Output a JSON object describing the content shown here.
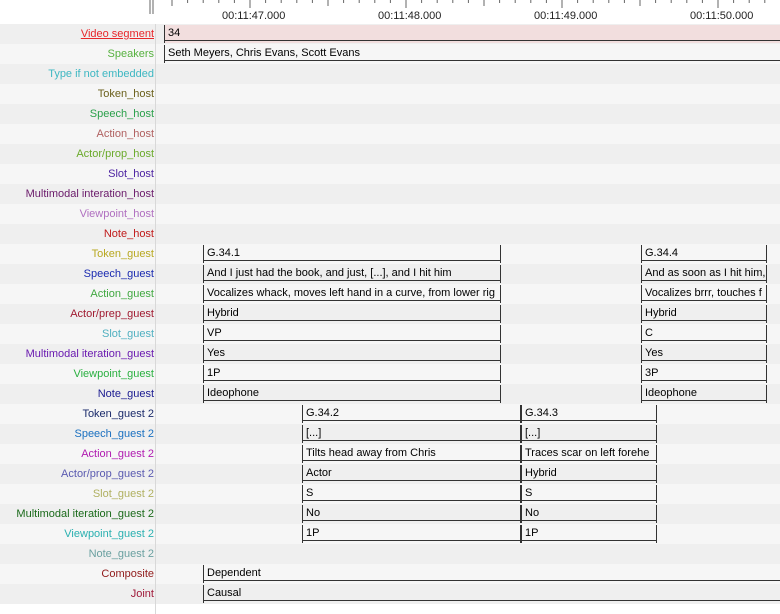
{
  "ruler": {
    "time_labels": [
      "00:11:47.000",
      "00:11:48.000",
      "00:11:49.000",
      "00:11:50.000"
    ]
  },
  "tiers": [
    {
      "label": "Video segment",
      "color": "#e8262a",
      "selected": true
    },
    {
      "label": "Speakers",
      "color": "#56b13f"
    },
    {
      "label": "Type if not embedded",
      "color": "#3db7c2"
    },
    {
      "label": "Token_host",
      "color": "#6a5f1a"
    },
    {
      "label": "Speech_host",
      "color": "#2aa04a"
    },
    {
      "label": "Action_host",
      "color": "#b06060"
    },
    {
      "label": "Actor/prop_host",
      "color": "#6aaa2a"
    },
    {
      "label": "Slot_host",
      "color": "#4a1fa0"
    },
    {
      "label": "Multimodal interation_host",
      "color": "#6a1a6a"
    },
    {
      "label": "Viewpoint_host",
      "color": "#b070c0"
    },
    {
      "label": "Note_host",
      "color": "#c01a1a"
    },
    {
      "label": "Token_guest",
      "color": "#b8a820"
    },
    {
      "label": "Speech_guest",
      "color": "#1a2ab0"
    },
    {
      "label": "Action_guest",
      "color": "#40a840"
    },
    {
      "label": "Actor/prep_guest",
      "color": "#a01a30"
    },
    {
      "label": "Slot_guest",
      "color": "#50b0c0"
    },
    {
      "label": "Multimodal iteration_guest",
      "color": "#6a1ab0"
    },
    {
      "label": "Viewpoint_guest",
      "color": "#2ab040"
    },
    {
      "label": "Note_guest",
      "color": "#1a1a90"
    },
    {
      "label": "Token_guest 2",
      "color": "#1a2a6a"
    },
    {
      "label": "Speech_guest 2",
      "color": "#1a70c0"
    },
    {
      "label": "Action_guest 2",
      "color": "#b01ab0"
    },
    {
      "label": "Actor/prop_guest 2",
      "color": "#5a5ab0"
    },
    {
      "label": "Slot_guest 2",
      "color": "#b0b060"
    },
    {
      "label": "Multimodal iteration_guest 2",
      "color": "#1a6a1a"
    },
    {
      "label": "Viewpoint_guest 2",
      "color": "#2ab0b0"
    },
    {
      "label": "Note_guest 2",
      "color": "#6aa0a0"
    },
    {
      "label": "Composite",
      "color": "#901a1a"
    },
    {
      "label": "Joint",
      "color": "#a01a3a"
    }
  ],
  "annotations": {
    "video_segment": "34",
    "speakers": "Seth Meyers, Chris Evans, Scott Evans",
    "guest_1": {
      "token": "G.34.1",
      "speech": "And I just had the book, and just, [...], and I hit him",
      "action": "Vocalizes whack, moves left hand in a curve, from lower rig",
      "actor_prop": "Hybrid",
      "slot": "VP",
      "multimodal": "Yes",
      "viewpoint": "1P",
      "note": "Ideophone"
    },
    "guest_4": {
      "token": "G.34.4",
      "speech": "And as soon as I hit him,",
      "action": "Vocalizes brrr, touches f",
      "actor_prop": "Hybrid",
      "slot": "C",
      "multimodal": "Yes",
      "viewpoint": "3P",
      "note": "Ideophone"
    },
    "guest2_2": {
      "token": "G.34.2",
      "speech": "[...]",
      "action": "Tilts head away from Chris",
      "actor_prop": "Actor",
      "slot": "S",
      "multimodal": "No",
      "viewpoint": "1P"
    },
    "guest2_3": {
      "token": "G.34.3",
      "speech": "[...]",
      "action": "Traces scar on left forehe",
      "actor_prop": "Hybrid",
      "slot": "S",
      "multimodal": "No",
      "viewpoint": "1P"
    },
    "composite": "Dependent",
    "joint": "Causal"
  }
}
